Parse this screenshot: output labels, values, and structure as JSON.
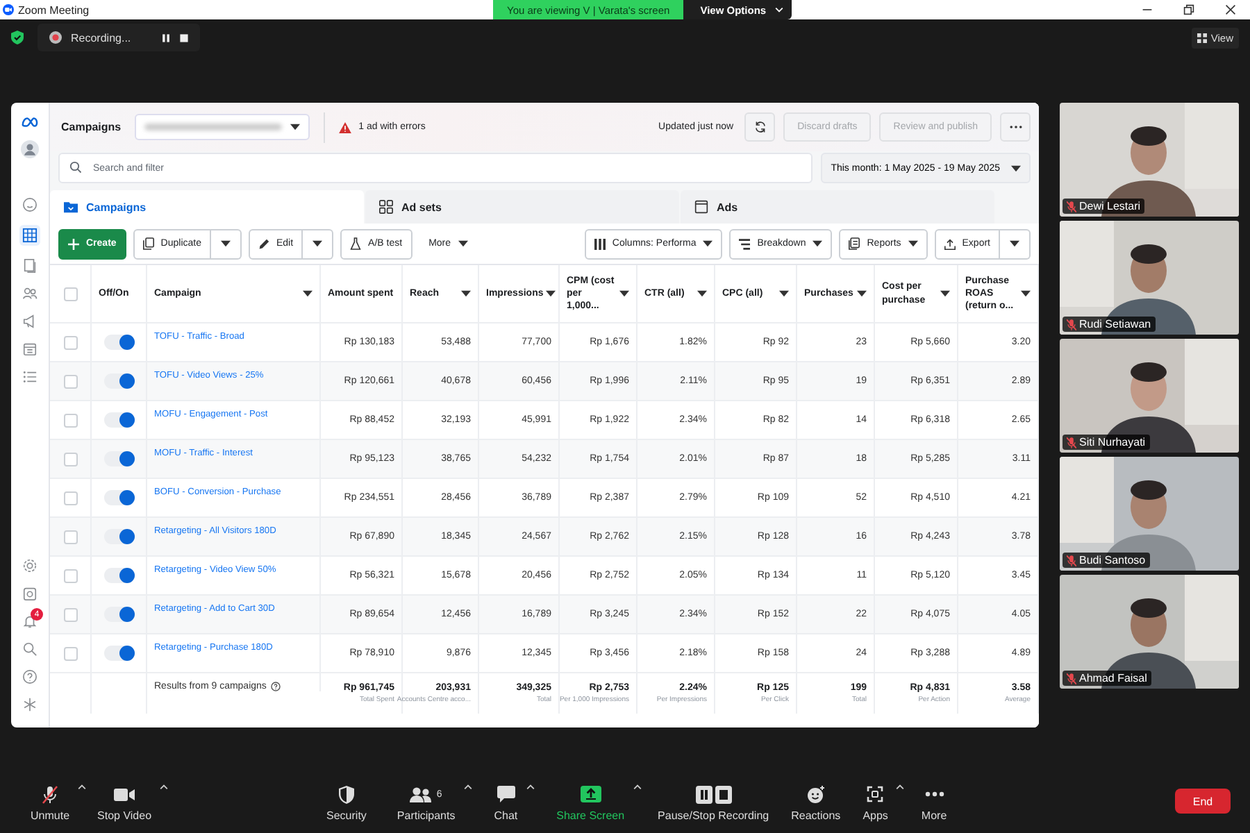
{
  "window": {
    "title": "Zoom Meeting"
  },
  "share_banner": {
    "text": "You are viewing V | Varata's screen",
    "button": "View Options"
  },
  "recording": {
    "label": "Recording..."
  },
  "view_button": "View",
  "ads_manager": {
    "title": "Campaigns",
    "error_notice": "1 ad with errors",
    "updated": "Updated just now",
    "header_buttons": [
      {
        "label": "Discard drafts",
        "disabled": true
      },
      {
        "label": "Review and publish",
        "disabled": true
      }
    ],
    "notification_count": "4",
    "search": {
      "placeholder": "Search and filter"
    },
    "date_range": "This month: 1 May 2025 - 19 May 2025",
    "tabs": [
      {
        "label": "Campaigns",
        "selected": true
      },
      {
        "label": "Ad sets",
        "selected": false
      },
      {
        "label": "Ads",
        "selected": false
      }
    ],
    "toolbar_left": [
      {
        "label": "Create",
        "kind": "create",
        "menu": false
      },
      {
        "label": "Duplicate",
        "kind": "duplicate",
        "menu": true,
        "split": true
      },
      {
        "label": "Edit",
        "kind": "edit",
        "menu": true,
        "split": true
      },
      {
        "label": "A/B test",
        "kind": "abtest",
        "menu": false
      },
      {
        "label": "More",
        "kind": "plain",
        "menu": true,
        "split": false
      }
    ],
    "toolbar_right": [
      {
        "label": "Columns: Performa",
        "kind": "columns",
        "menu": true,
        "split": false
      },
      {
        "label": "Breakdown",
        "kind": "breakdown",
        "menu": true,
        "split": false
      },
      {
        "label": "Reports",
        "kind": "reports",
        "menu": true,
        "split": false
      },
      {
        "label": "Export",
        "kind": "export",
        "menu": true,
        "split": true
      }
    ],
    "table": {
      "select_all": {
        "checked": false
      },
      "toggle_header": {
        "label": "Off/On"
      },
      "name_header": {
        "label": "Campaign",
        "menu": true
      },
      "columns": [
        {
          "label": "Amount spent",
          "menu": false
        },
        {
          "label": "Reach",
          "menu": true
        },
        {
          "label": "Impressions",
          "menu": true
        },
        {
          "label": "CPM (cost per 1,000...",
          "menu": true
        },
        {
          "label": "CTR (all)",
          "menu": true
        },
        {
          "label": "CPC (all)",
          "menu": true
        },
        {
          "label": "Purchases",
          "menu": true
        },
        {
          "label": "Cost per purchase",
          "menu": true
        },
        {
          "label": "Purchase ROAS (return o...",
          "menu": true
        }
      ],
      "rows": [
        {
          "checked": false,
          "on": true,
          "campaign": "TOFU - Traffic - Broad",
          "cells": [
            "Rp 130,183",
            "53,488",
            "77,700",
            "Rp 1,676",
            "1.82%",
            "Rp 92",
            "23",
            "Rp 5,660",
            "3.20"
          ]
        },
        {
          "checked": false,
          "on": true,
          "campaign": "TOFU - Video Views - 25%",
          "cells": [
            "Rp 120,661",
            "40,678",
            "60,456",
            "Rp 1,996",
            "2.11%",
            "Rp 95",
            "19",
            "Rp 6,351",
            "2.89"
          ]
        },
        {
          "checked": false,
          "on": true,
          "campaign": "MOFU - Engagement - Post",
          "cells": [
            "Rp 88,452",
            "32,193",
            "45,991",
            "Rp 1,922",
            "2.34%",
            "Rp 82",
            "14",
            "Rp 6,318",
            "2.65"
          ]
        },
        {
          "checked": false,
          "on": true,
          "campaign": "MOFU - Traffic - Interest",
          "cells": [
            "Rp 95,123",
            "38,765",
            "54,232",
            "Rp 1,754",
            "2.01%",
            "Rp 87",
            "18",
            "Rp 5,285",
            "3.11"
          ]
        },
        {
          "checked": false,
          "on": true,
          "campaign": "BOFU - Conversion - Purchase",
          "cells": [
            "Rp 234,551",
            "28,456",
            "36,789",
            "Rp 2,387",
            "2.79%",
            "Rp 109",
            "52",
            "Rp 4,510",
            "4.21"
          ]
        },
        {
          "checked": false,
          "on": true,
          "campaign": "Retargeting - All Visitors 180D",
          "cells": [
            "Rp 67,890",
            "18,345",
            "24,567",
            "Rp 2,762",
            "2.15%",
            "Rp 128",
            "16",
            "Rp 4,243",
            "3.78"
          ]
        },
        {
          "checked": false,
          "on": true,
          "campaign": "Retargeting - Video View 50%",
          "cells": [
            "Rp 56,321",
            "15,678",
            "20,456",
            "Rp 2,752",
            "2.05%",
            "Rp 134",
            "11",
            "Rp 5,120",
            "3.45"
          ]
        },
        {
          "checked": false,
          "on": true,
          "campaign": "Retargeting - Add to Cart 30D",
          "cells": [
            "Rp 89,654",
            "12,456",
            "16,789",
            "Rp 3,245",
            "2.34%",
            "Rp 152",
            "22",
            "Rp 4,075",
            "4.05"
          ]
        },
        {
          "checked": false,
          "on": true,
          "campaign": "Retargeting - Purchase 180D",
          "cells": [
            "Rp 78,910",
            "9,876",
            "12,345",
            "Rp 3,456",
            "2.18%",
            "Rp 158",
            "24",
            "Rp 3,288",
            "4.89"
          ]
        }
      ],
      "footer": {
        "label": "Results from 9 campaigns",
        "totals": [
          {
            "value": "Rp 961,745",
            "note": "Total Spent"
          },
          {
            "value": "203,931",
            "note": "Accounts Centre acco..."
          },
          {
            "value": "349,325",
            "note": "Total"
          },
          {
            "value": "Rp 2,753",
            "note": "Per 1,000 Impressions"
          },
          {
            "value": "2.24%",
            "note": "Per Impressions"
          },
          {
            "value": "Rp 125",
            "note": "Per Click"
          },
          {
            "value": "199",
            "note": "Total"
          },
          {
            "value": "Rp 4,831",
            "note": "Per Action"
          },
          {
            "value": "3.58",
            "note": "Average"
          }
        ]
      }
    }
  },
  "participants": [
    {
      "name": "Dewi Lestari",
      "muted": true
    },
    {
      "name": "Rudi Setiawan",
      "muted": true
    },
    {
      "name": "Siti Nurhayati",
      "muted": true
    },
    {
      "name": "Budi Santoso",
      "muted": true
    },
    {
      "name": "Ahmad Faisal",
      "muted": true
    }
  ],
  "meeting_controls": [
    {
      "label": "Unmute",
      "kind": "mic",
      "caret": true
    },
    {
      "label": "Stop Video",
      "kind": "video",
      "caret": true
    },
    {
      "label": "Security",
      "kind": "security",
      "caret": false
    },
    {
      "label": "Participants",
      "kind": "participants",
      "count": "6",
      "caret": true
    },
    {
      "label": "Chat",
      "kind": "chat",
      "caret": true
    },
    {
      "label": "Share Screen",
      "kind": "share",
      "caret": true
    },
    {
      "label": "Pause/Stop Recording",
      "kind": "recording",
      "caret": false
    },
    {
      "label": "Reactions",
      "kind": "reactions",
      "caret": false
    },
    {
      "label": "Apps",
      "kind": "apps",
      "caret": true
    },
    {
      "label": "More",
      "kind": "more",
      "caret": false
    }
  ],
  "end_button": "End"
}
